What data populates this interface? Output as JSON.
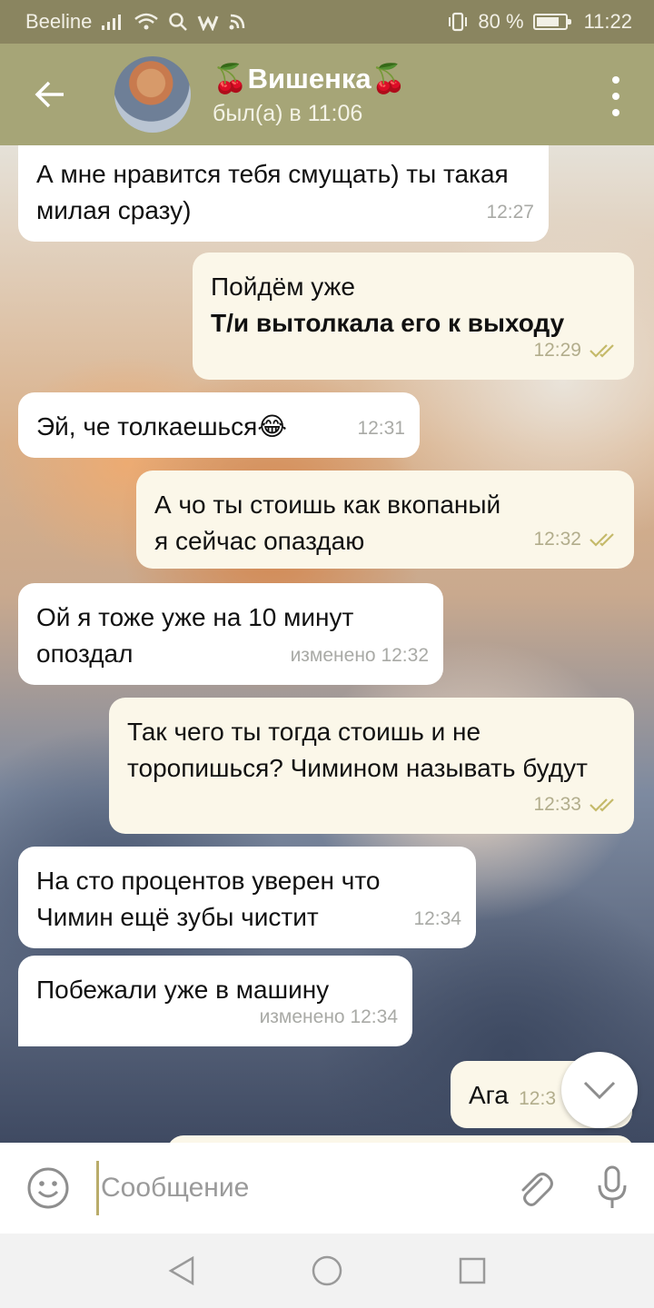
{
  "status_bar": {
    "carrier": "Beeline",
    "battery_text": "80 %",
    "battery_level": 0.8,
    "time": "11:22"
  },
  "header": {
    "back_icon": "arrow-left-icon",
    "title": "Вишенка",
    "title_emoji": "🍒",
    "subtitle": "был(а) в 11:06",
    "menu_icon": "more-vertical-icon"
  },
  "messages": [
    {
      "direction": "in",
      "text": "А мне нравится тебя смущать) ты такая милая сразу)",
      "time": "12:27"
    },
    {
      "direction": "out",
      "text": "Пойдём уже",
      "bold": "Т/и вытолкала его к выходу",
      "time": "12:29"
    },
    {
      "direction": "in",
      "text": "Эй, че толкаешься😂",
      "time": "12:31"
    },
    {
      "direction": "out",
      "text": "А чо ты стоишь как вкопаный я сейчас опаздаю",
      "time": "12:32"
    },
    {
      "direction": "in",
      "text": "Ой я тоже уже на 10 минут опоздал",
      "time": "изменено 12:32"
    },
    {
      "direction": "out",
      "text": "Так чего ты тогда стоишь и не торопишься? Чимином называть будут",
      "time": "12:33"
    },
    {
      "direction": "in",
      "text": "На сто процентов уверен что Чимин ещё зубы чистит",
      "time": "12:34"
    },
    {
      "direction": "in",
      "text": "Побежали уже в машину",
      "time": "изменено 12:34"
    },
    {
      "direction": "out",
      "text": "Ага",
      "time": "12:3"
    }
  ],
  "input": {
    "placeholder": "Сообщение",
    "emoji_icon": "emoji-icon",
    "attach_icon": "paperclip-icon",
    "mic_icon": "microphone-icon"
  },
  "colors": {
    "header": "#a6a577",
    "status_bar": "#8a8560",
    "incoming_bubble": "#ffffff",
    "outgoing_bubble": "#fbf7e9",
    "checkmarks": "#c5ba6a"
  }
}
